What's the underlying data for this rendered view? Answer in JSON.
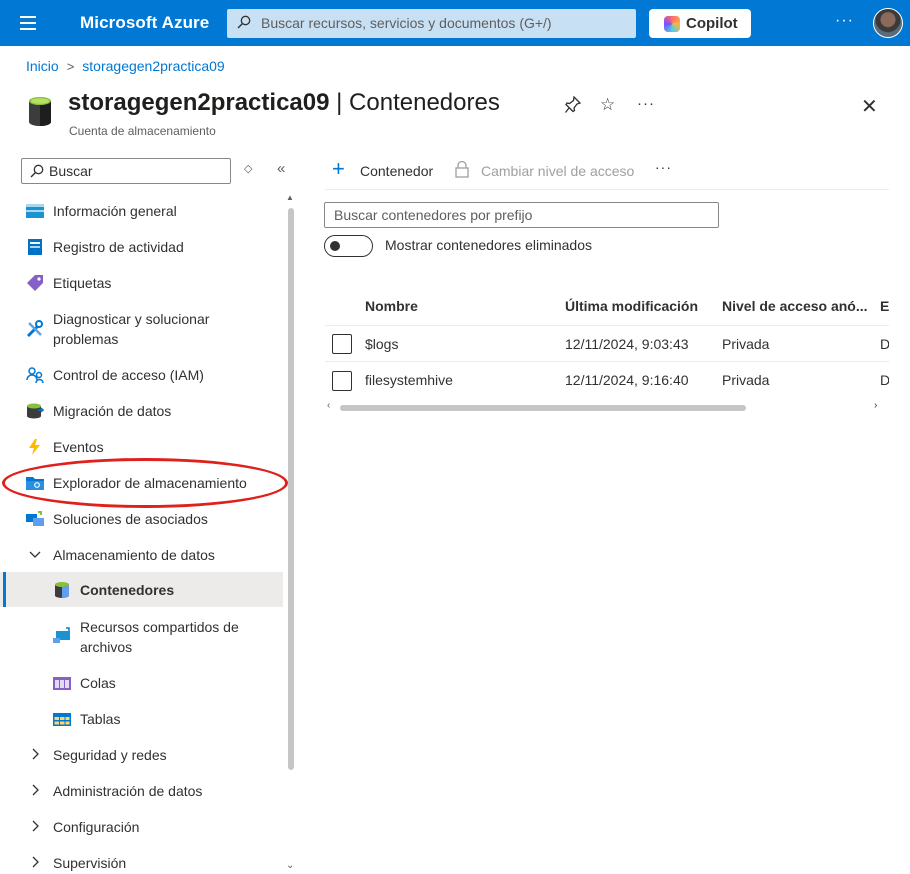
{
  "topbar": {
    "brand": "Microsoft Azure",
    "search_placeholder": "Buscar recursos, servicios y documentos (G+/)",
    "copilot_label": "Copilot",
    "more": "···",
    "accent": "#0078d4"
  },
  "breadcrumb": {
    "home": "Inicio",
    "resource": "storagegen2practica09"
  },
  "header": {
    "resource_name": "storagegen2practica09",
    "separator": " | ",
    "section": "Contenedores",
    "subtitle": "Cuenta de almacenamiento",
    "more": "···"
  },
  "sidebar": {
    "search_placeholder": "Buscar",
    "items": [
      {
        "label": "Información general",
        "icon": "overview-icon"
      },
      {
        "label": "Registro de actividad",
        "icon": "activity-log-icon"
      },
      {
        "label": "Etiquetas",
        "icon": "tag-icon"
      },
      {
        "label": "Diagnosticar y solucionar problemas",
        "icon": "diagnose-icon"
      },
      {
        "label": "Control de acceso (IAM)",
        "icon": "iam-icon"
      },
      {
        "label": "Migración de datos",
        "icon": "data-migration-icon"
      },
      {
        "label": "Eventos",
        "icon": "events-icon"
      },
      {
        "label": "Explorador de almacenamiento",
        "icon": "storage-explorer-icon"
      },
      {
        "label": "Soluciones de asociados",
        "icon": "partner-solutions-icon"
      },
      {
        "label": "Almacenamiento de datos",
        "icon": "chevron-down-icon"
      },
      {
        "label": "Contenedores",
        "icon": "containers-icon"
      },
      {
        "label": "Recursos compartidos de archivos",
        "icon": "file-shares-icon"
      },
      {
        "label": "Colas",
        "icon": "queues-icon"
      },
      {
        "label": "Tablas",
        "icon": "tables-icon"
      },
      {
        "label": "Seguridad y redes",
        "icon": "chevron-right-icon"
      },
      {
        "label": "Administración de datos",
        "icon": "chevron-right-icon"
      },
      {
        "label": "Configuración",
        "icon": "chevron-right-icon"
      },
      {
        "label": "Supervisión",
        "icon": "chevron-right-icon"
      }
    ]
  },
  "toolbar": {
    "add_label": "Contenedor",
    "change_access_label": "Cambiar nivel de acceso",
    "more": "···"
  },
  "filter": {
    "placeholder": "Buscar contenedores por prefijo",
    "toggle_label": "Mostrar contenedores eliminados"
  },
  "table": {
    "columns": [
      "Nombre",
      "Última modificación",
      "Nivel de acceso anó...",
      "E"
    ],
    "rows": [
      {
        "name": "$logs",
        "modified": "12/11/2024, 9:03:43",
        "access": "Privada",
        "extra": "D"
      },
      {
        "name": "filesystemhive",
        "modified": "12/11/2024, 9:16:40",
        "access": "Privada",
        "extra": "D"
      }
    ]
  }
}
